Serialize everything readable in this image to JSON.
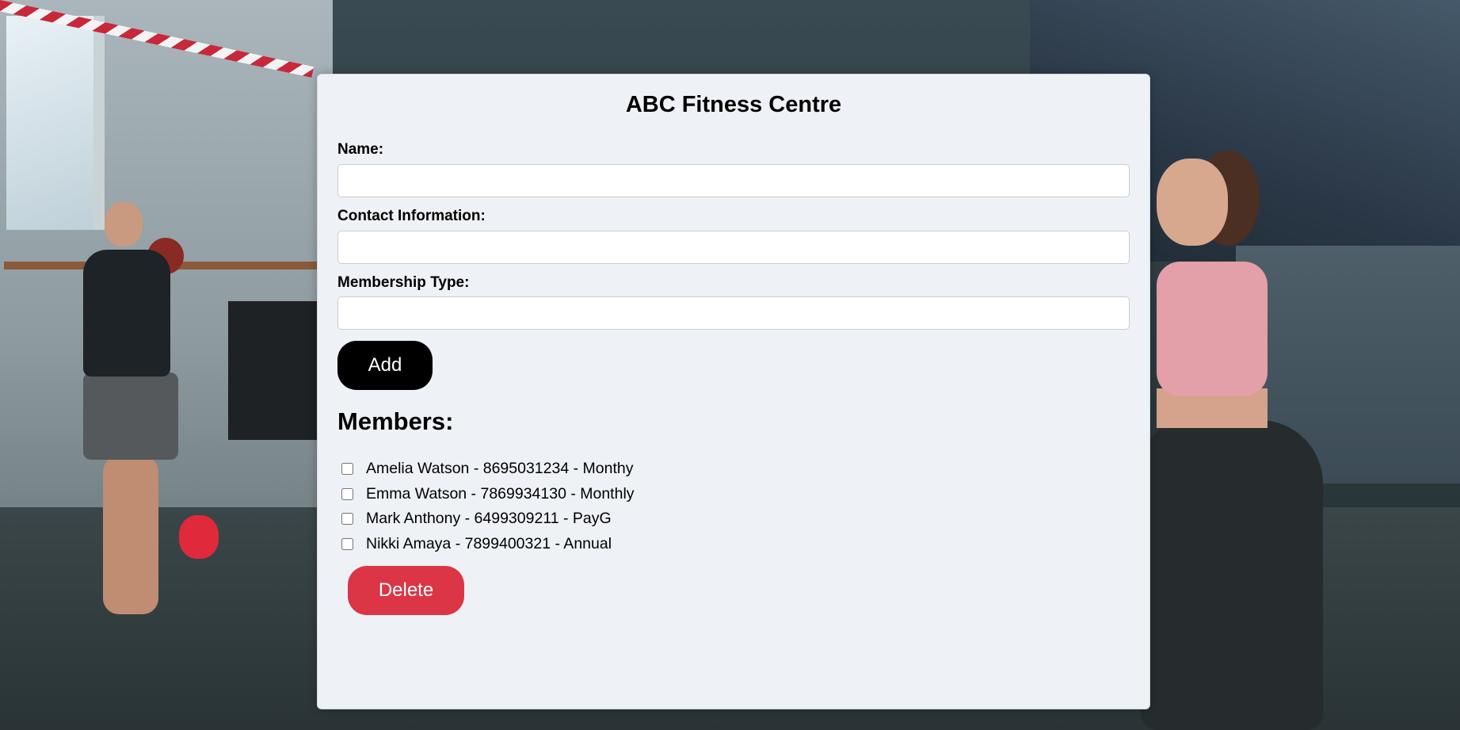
{
  "app": {
    "title": "ABC Fitness Centre"
  },
  "form": {
    "name_label": "Name:",
    "name_value": "",
    "contact_label": "Contact Information:",
    "contact_value": "",
    "membership_label": "Membership Type:",
    "membership_value": "",
    "add_label": "Add"
  },
  "members": {
    "heading": "Members:",
    "items": [
      {
        "text": "Amelia Watson - 8695031234 - Monthy",
        "checked": false
      },
      {
        "text": "Emma Watson - 7869934130 - Monthly",
        "checked": false
      },
      {
        "text": "Mark Anthony - 6499309211 - PayG",
        "checked": false
      },
      {
        "text": "Nikki Amaya - 7899400321 - Annual",
        "checked": false
      }
    ],
    "delete_label": "Delete"
  },
  "colors": {
    "add_button": "#000000",
    "delete_button": "#dc3545",
    "panel_background": "#eef1f5"
  }
}
